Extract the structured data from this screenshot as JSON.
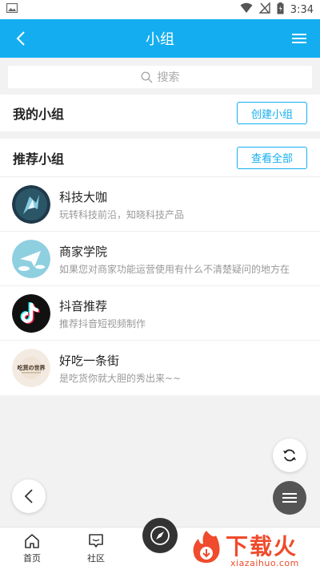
{
  "status_bar": {
    "time": "3:34"
  },
  "header": {
    "title": "小组"
  },
  "search": {
    "placeholder": "搜索"
  },
  "my_groups": {
    "title": "我的小组",
    "create_label": "创建小组"
  },
  "recommended": {
    "title": "推荐小组",
    "view_all_label": "查看全部"
  },
  "groups": [
    {
      "name": "科技大咖",
      "desc": "玩转科技前沿，知晓科技产品"
    },
    {
      "name": "商家学院",
      "desc": "如果您对商家功能运营使用有什么不清楚疑问的地方在"
    },
    {
      "name": "抖音推荐",
      "desc": "推荐抖音短视频制作"
    },
    {
      "name": "好吃一条街",
      "desc": "是吃货你就大胆的秀出来~~",
      "avatar_text": "吃货の世界"
    }
  ],
  "bottom_nav": {
    "home_label": "首页",
    "community_label": "社区"
  },
  "watermark": {
    "brand": "下载火",
    "url": "xiazaihuo.com"
  },
  "colors": {
    "accent": "#14aef0",
    "watermark": "#ef4b2c"
  }
}
